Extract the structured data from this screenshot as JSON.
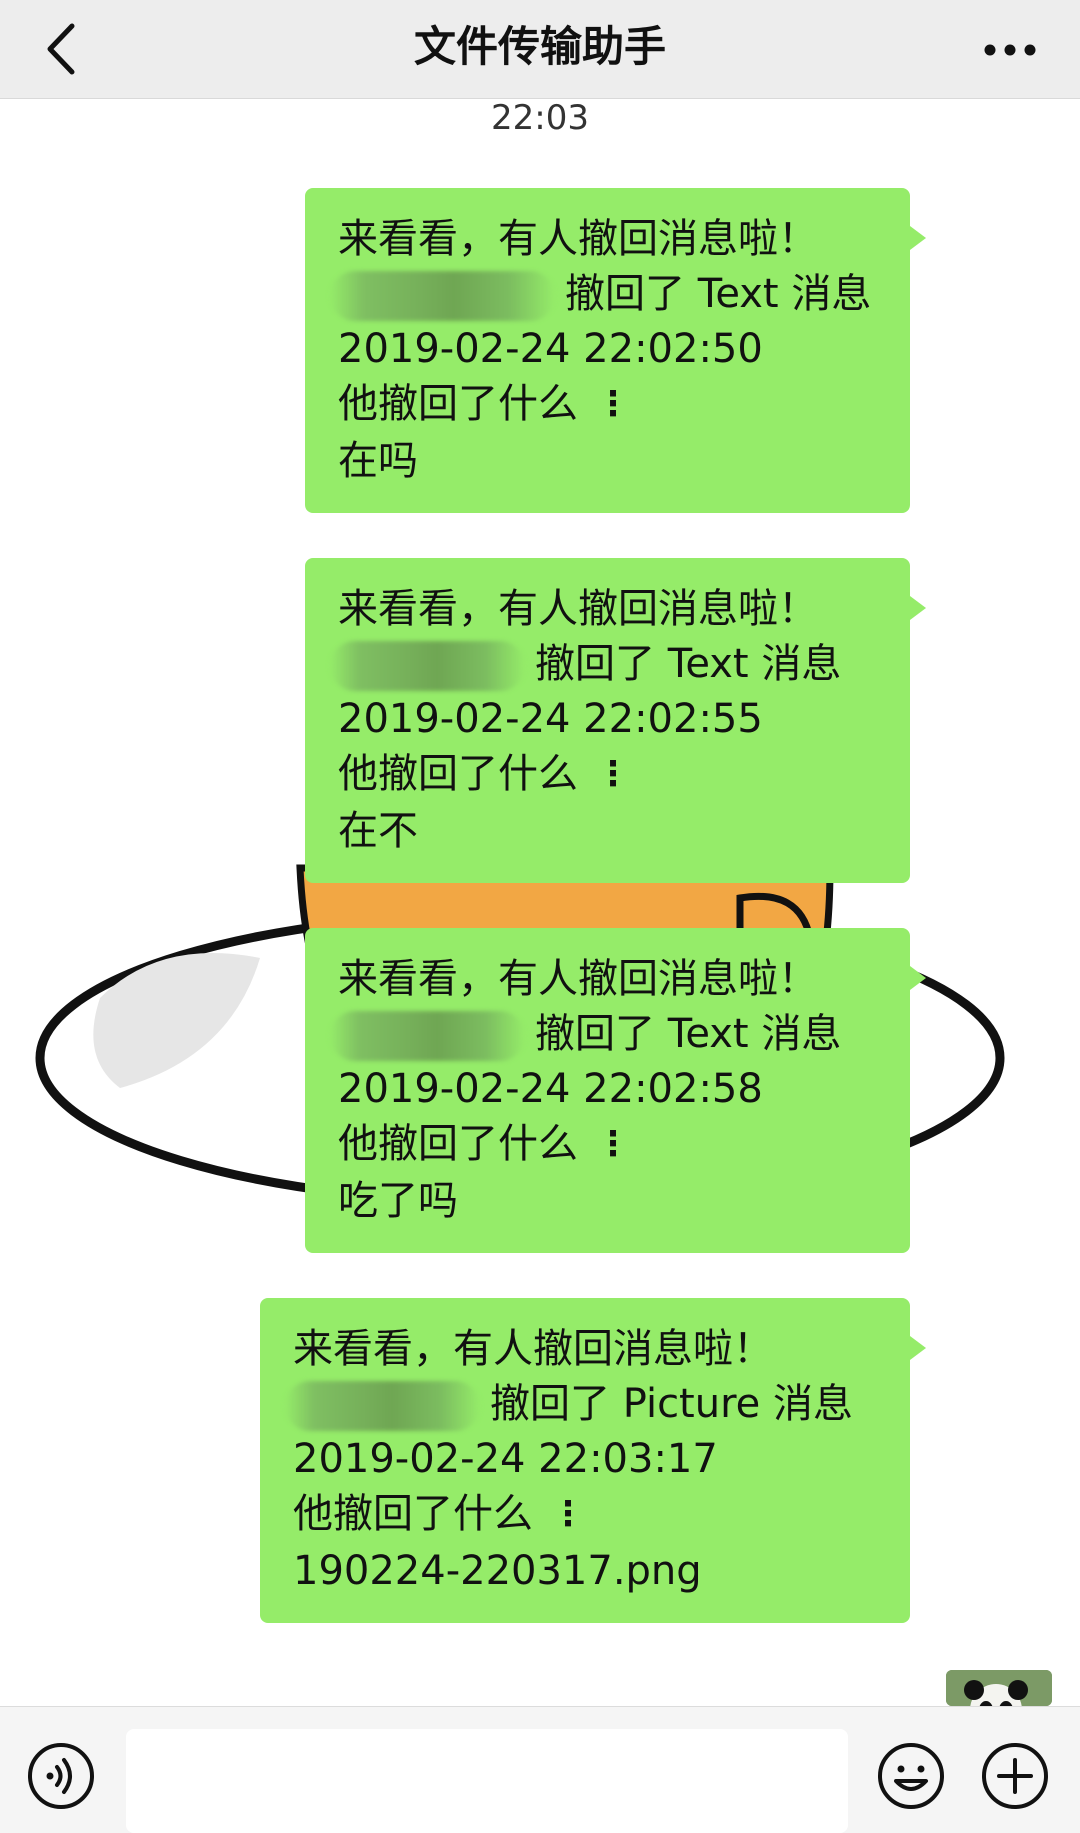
{
  "header": {
    "title": "文件传输助手",
    "back_icon": "chevron-left-icon",
    "more_icon": "more-dots-icon"
  },
  "timestamp": "22:03",
  "messages": [
    {
      "line1": "来看看，有人撤回消息啦！",
      "line2_suffix": "撤回了 Text 消息",
      "line3": "2019-02-24 22:02:50",
      "line4": "他撤回了什么",
      "line5": "在吗"
    },
    {
      "line1": "来看看，有人撤回消息啦！",
      "line2_suffix": "撤回了 Text 消息",
      "line3": "2019-02-24 22:02:55",
      "line4": "他撤回了什么",
      "line5": "在不"
    },
    {
      "line1": "来看看，有人撤回消息啦！",
      "line2_suffix": "撤回了 Text 消息",
      "line3": "2019-02-24 22:02:58",
      "line4": "他撤回了什么",
      "line5": "吃了吗"
    },
    {
      "line1": "来看看，有人撤回消息啦！",
      "line2_suffix": "撤回了 Picture 消息",
      "line3": "2019-02-24 22:03:17",
      "line4": "他撤回了什么",
      "line5": "190224-220317.png"
    }
  ],
  "more_glyph": "⋮",
  "bottom_bar": {
    "voice_icon": "voice-icon",
    "input_value": "",
    "emoji_icon": "emoji-icon",
    "plus_icon": "plus-icon"
  },
  "colors": {
    "bubble": "#95ec69",
    "header_bg": "#ededed",
    "bottom_bg": "#f5f5f5"
  }
}
